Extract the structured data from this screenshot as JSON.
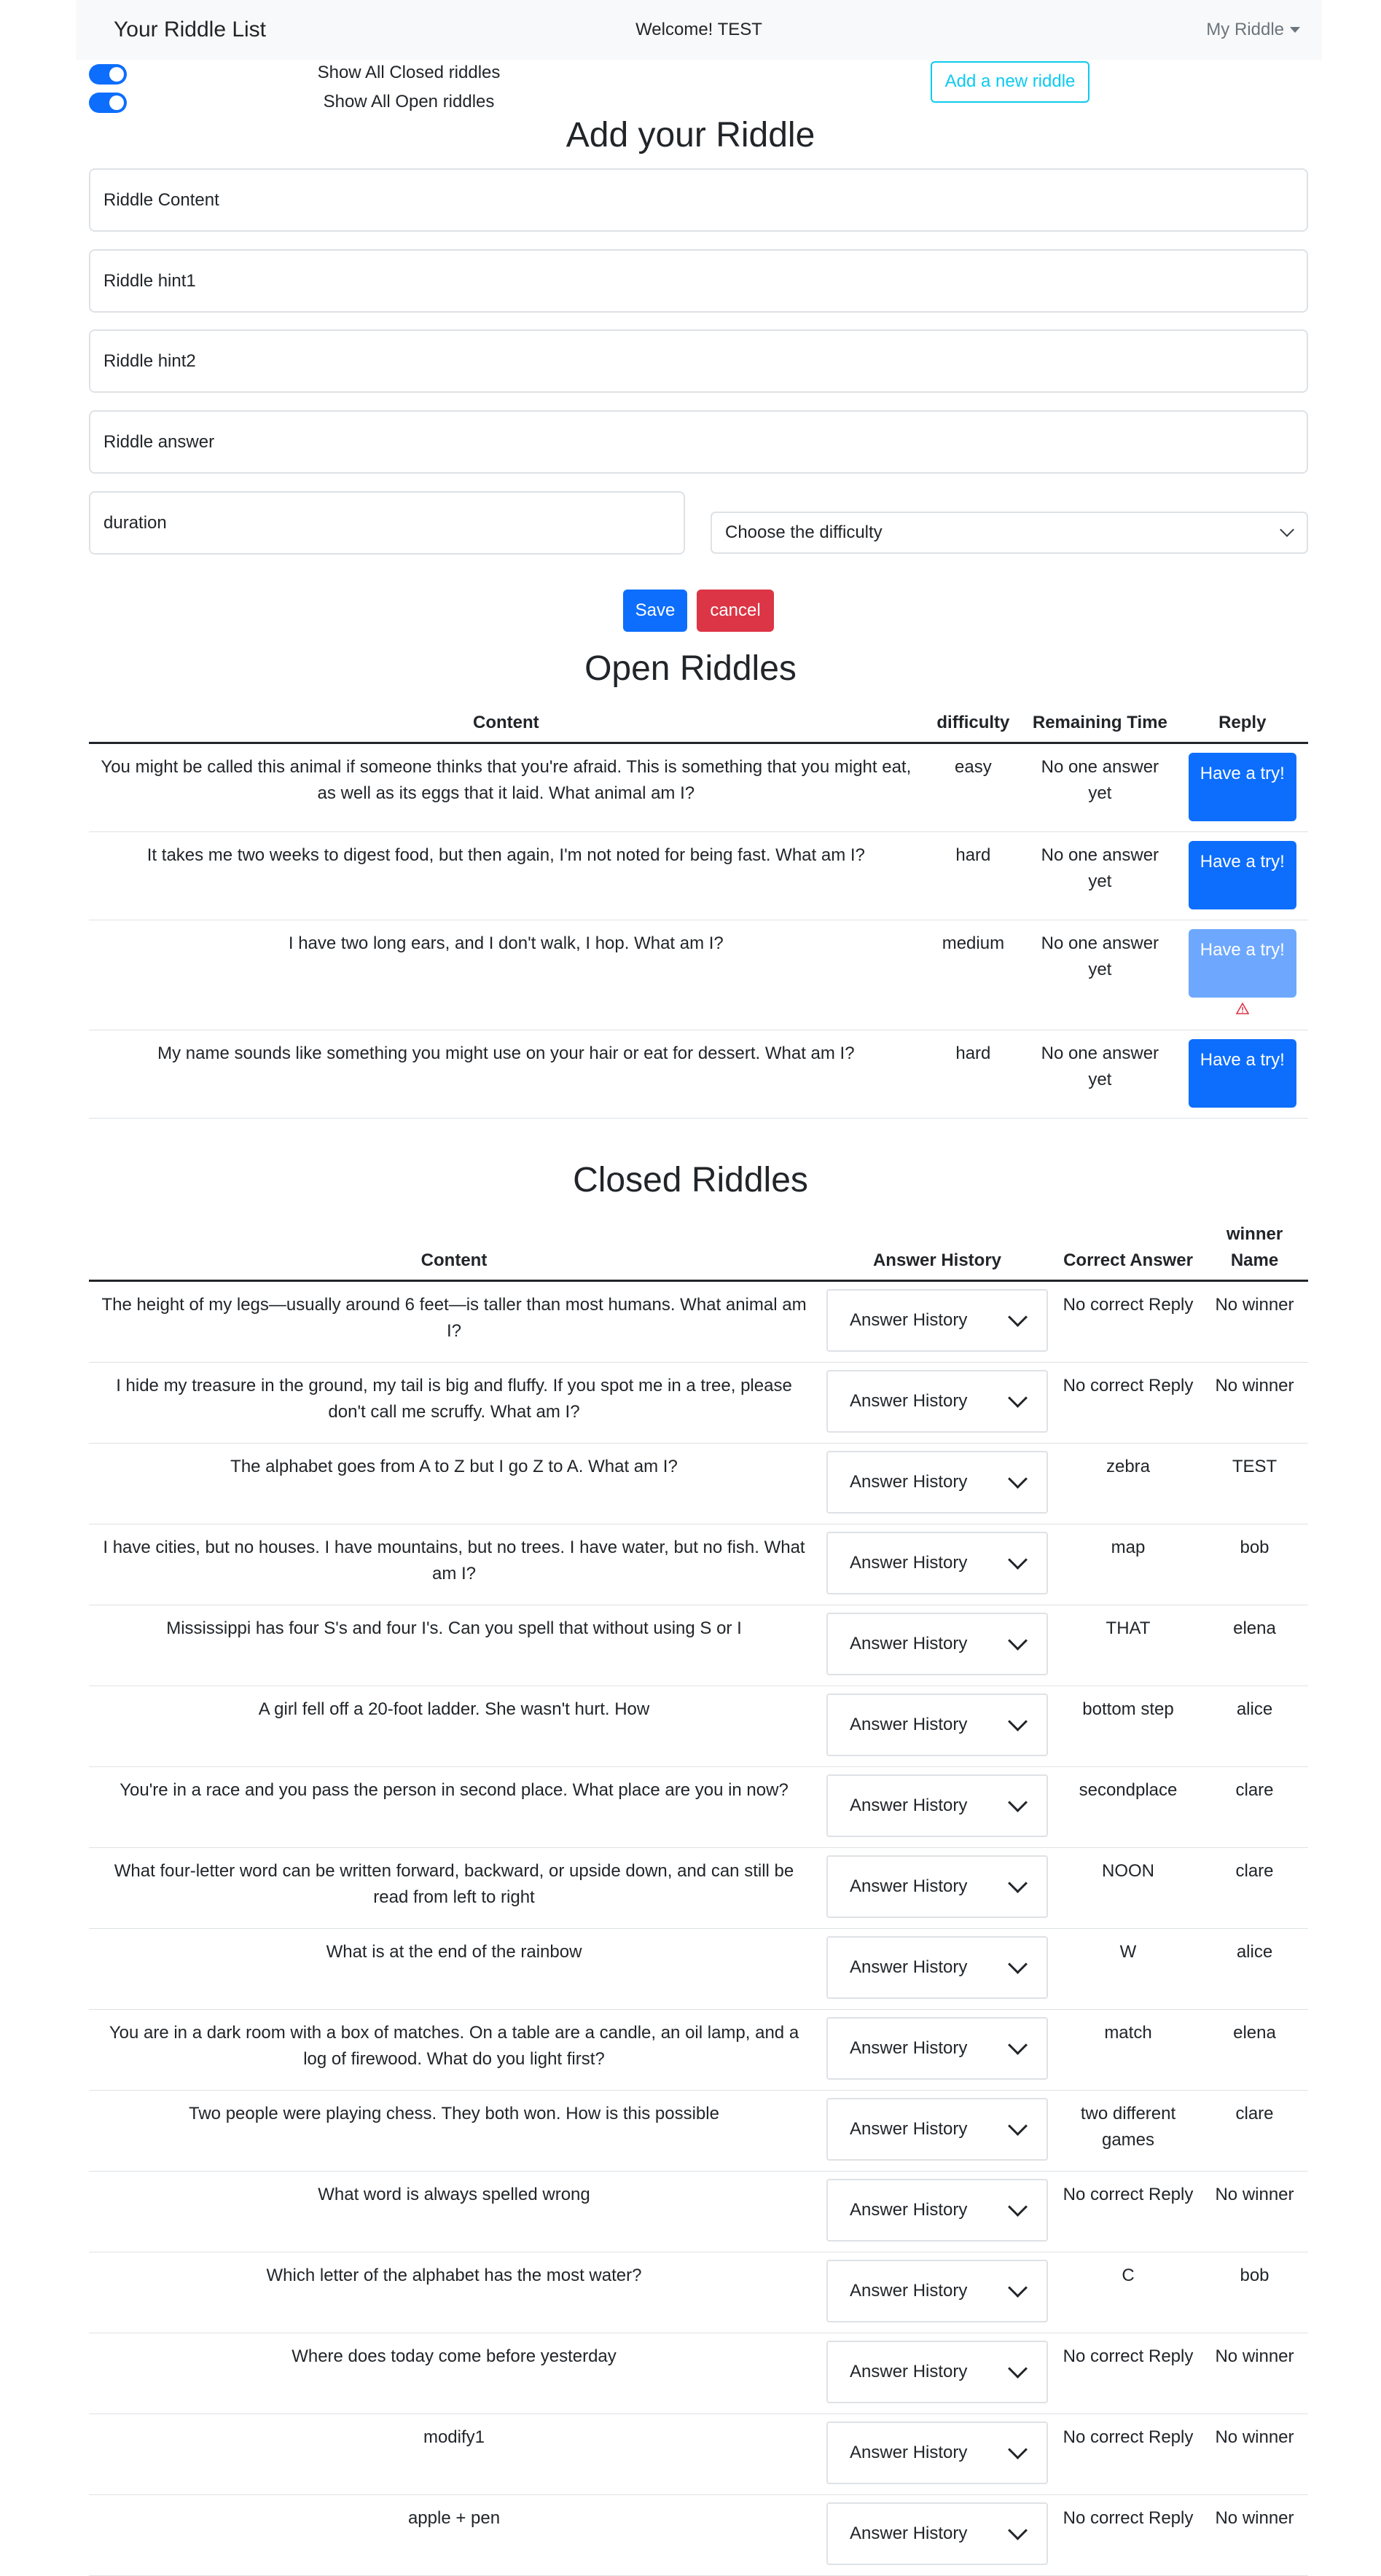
{
  "navbar": {
    "brand": "Your Riddle List",
    "welcome": "Welcome! TEST",
    "menu": "My Riddle"
  },
  "toggles": {
    "closed_label": "Show All Closed riddles",
    "open_label": "Show All Open riddles"
  },
  "add_button": "Add a new riddle",
  "form": {
    "title": "Add your Riddle",
    "content_placeholder": "Riddle Content",
    "hint1_placeholder": "Riddle hint1",
    "hint2_placeholder": "Riddle hint2",
    "answer_placeholder": "Riddle answer",
    "duration_placeholder": "duration",
    "difficulty_select": "Choose the difficulty",
    "save_label": "Save",
    "cancel_label": "cancel"
  },
  "open": {
    "title": "Open Riddles",
    "headers": {
      "content": "Content",
      "difficulty": "difficulty",
      "remaining": "Remaining Time",
      "reply": "Reply"
    },
    "rows": [
      {
        "content": "You might be called this animal if someone thinks that you're afraid. This is something that you might eat, as well as its eggs that it laid. What animal am I?",
        "difficulty": "easy",
        "remaining": "No one answer yet",
        "reply": "Have a try!"
      },
      {
        "content": "It takes me two weeks to digest food, but then again, I'm not noted for being fast. What am I?",
        "difficulty": "hard",
        "remaining": "No one answer yet",
        "reply": "Have a try!"
      },
      {
        "content": "I have two long ears, and I don't walk, I hop. What am I?",
        "difficulty": "medium",
        "remaining": "No one answer yet",
        "reply": "Have a try!"
      },
      {
        "content": "My name sounds like something you might use on your hair or eat for dessert. What am I?",
        "difficulty": "hard",
        "remaining": "No one answer yet",
        "reply": "Have a try!"
      }
    ]
  },
  "closed": {
    "title": "Closed Riddles",
    "headers": {
      "content": "Content",
      "history": "Answer History",
      "correct": "Correct Answer",
      "winner": "winner Name"
    },
    "rows": [
      {
        "content": "The height of my legs—usually around 6 feet—is taller than most humans. What animal am I?",
        "history": "Answer History",
        "correct": "No correct Reply",
        "winner": "No winner"
      },
      {
        "content": "I hide my treasure in the ground, my tail is big and fluffy. If you spot me in a tree, please don't call me scruffy. What am I?",
        "history": "Answer History",
        "correct": "No correct Reply",
        "winner": "No winner"
      },
      {
        "content": "The alphabet goes from A to Z but I go Z to A. What am I?",
        "history": "Answer History",
        "correct": "zebra",
        "winner": "TEST"
      },
      {
        "content": "I have cities, but no houses. I have mountains, but no trees. I have water, but no fish. What am I?",
        "history": "Answer History",
        "correct": "map",
        "winner": "bob"
      },
      {
        "content": "Mississippi has four S's and four I's. Can you spell that without using S or I",
        "history": "Answer History",
        "correct": "THAT",
        "winner": "elena"
      },
      {
        "content": "A girl fell off a 20-foot ladder. She wasn't hurt. How",
        "history": "Answer History",
        "correct": "bottom step",
        "winner": "alice"
      },
      {
        "content": "You're in a race and you pass the person in second place. What place are you in now?",
        "history": "Answer History",
        "correct": "secondplace",
        "winner": "clare"
      },
      {
        "content": "What four-letter word can be written forward, backward, or upside down, and can still be read from left to right",
        "history": "Answer History",
        "correct": "NOON",
        "winner": "clare"
      },
      {
        "content": "What is at the end of the rainbow",
        "history": "Answer History",
        "correct": "W",
        "winner": "alice"
      },
      {
        "content": "You are in a dark room with a box of matches. On a table are a candle, an oil lamp, and a log of firewood. What do you light first?",
        "history": "Answer History",
        "correct": "match",
        "winner": "elena"
      },
      {
        "content": "Two people were playing chess. They both won. How is this possible",
        "history": "Answer History",
        "correct": "two different games",
        "winner": "clare"
      },
      {
        "content": "What word is always spelled wrong",
        "history": "Answer History",
        "correct": "No correct Reply",
        "winner": "No winner"
      },
      {
        "content": "Which letter of the alphabet has the most water?",
        "history": "Answer History",
        "correct": "C",
        "winner": "bob"
      },
      {
        "content": "Where does today come before yesterday",
        "history": "Answer History",
        "correct": "No correct Reply",
        "winner": "No winner"
      },
      {
        "content": "modify1",
        "history": "Answer History",
        "correct": "No correct Reply",
        "winner": "No winner"
      },
      {
        "content": "apple + pen",
        "history": "Answer History",
        "correct": "No correct Reply",
        "winner": "No winner"
      }
    ]
  },
  "colors": {
    "primary": "#0d6efd",
    "danger": "#dc3545",
    "info": "#0dcaf0",
    "navbar_bg": "#f8f9fa",
    "disabled_primary": "#6ea8fe"
  }
}
